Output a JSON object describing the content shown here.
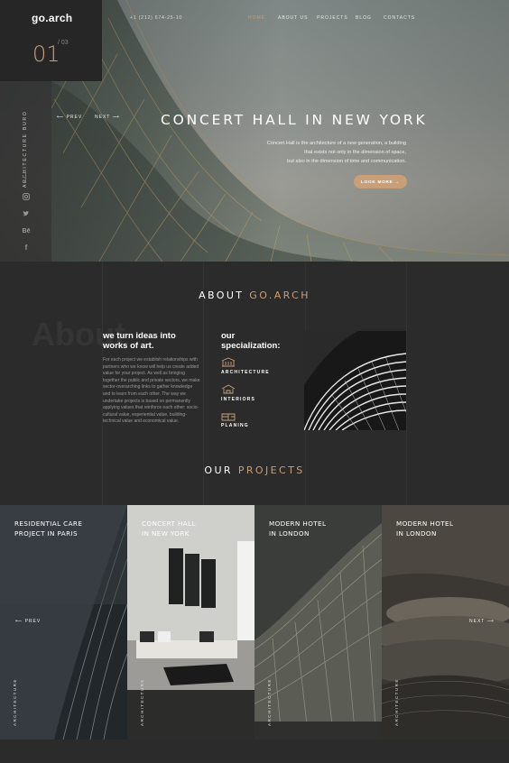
{
  "brand": {
    "logo": "go.arch",
    "tagline": "ARCHITECTURE BURO"
  },
  "slider": {
    "current": "01",
    "total": "/ 03",
    "prev": "PREV",
    "next": "NEXT"
  },
  "header": {
    "phone": "+1 (212) 674-25-10",
    "nav": [
      "HOME",
      "ABOUT US",
      "PROJECTS",
      "BLOG",
      "CONTACTS"
    ],
    "active_index": 0
  },
  "social": [
    "instagram-icon",
    "twitter-icon",
    "behance-icon",
    "facebook-icon"
  ],
  "hero": {
    "title": "CONCERT HALL IN NEW YORK",
    "desc": [
      "Concert Hall is the architecture of a new generation, a building",
      "that exists not only in the dimension of space,",
      "but also in the dimension of time and communication."
    ],
    "button": "LOOK MORE"
  },
  "about": {
    "title_plain": "ABOUT ",
    "title_accent": "GO.ARCH",
    "watermark": "About",
    "heading_line1": "we turn ideas into",
    "heading_line2": "works of art.",
    "text": "For each project we establish relationships with partners who we know will help us create added value for your project. As well as bringing together the public and private sectors, we make sector-overarching links to gather knowledge and to learn from each other. The way we undertake projects is based on permanently applying values that reinforce each other: socio-cultural value, experiential value, building-technical value and economical value.",
    "spec_line1": "our",
    "spec_line2": "specialization",
    "spec_items": [
      "ARCHITECTURE",
      "INTERIORS",
      "PLANING"
    ]
  },
  "projects": {
    "title_plain": "OUR ",
    "title_accent": "PROJECTS",
    "prev": "PREV",
    "next": "NEXT",
    "cards": [
      {
        "title_l1": "Residential Care",
        "title_l2": "Project in Paris",
        "category": "ARCHITECTURE"
      },
      {
        "title_l1": "Concert Hall",
        "title_l2": "in New York",
        "category": "ARCHITECTURE"
      },
      {
        "title_l1": "Modern Hotel",
        "title_l2": "in London",
        "category": "ARCHITECTURE"
      },
      {
        "title_l1": "Modern Hotel",
        "title_l2": "in London",
        "category": "ARCHITECTURE"
      }
    ]
  },
  "colors": {
    "accent": "#c89f78",
    "background": "#2b2b2b",
    "panel": "#262626"
  }
}
